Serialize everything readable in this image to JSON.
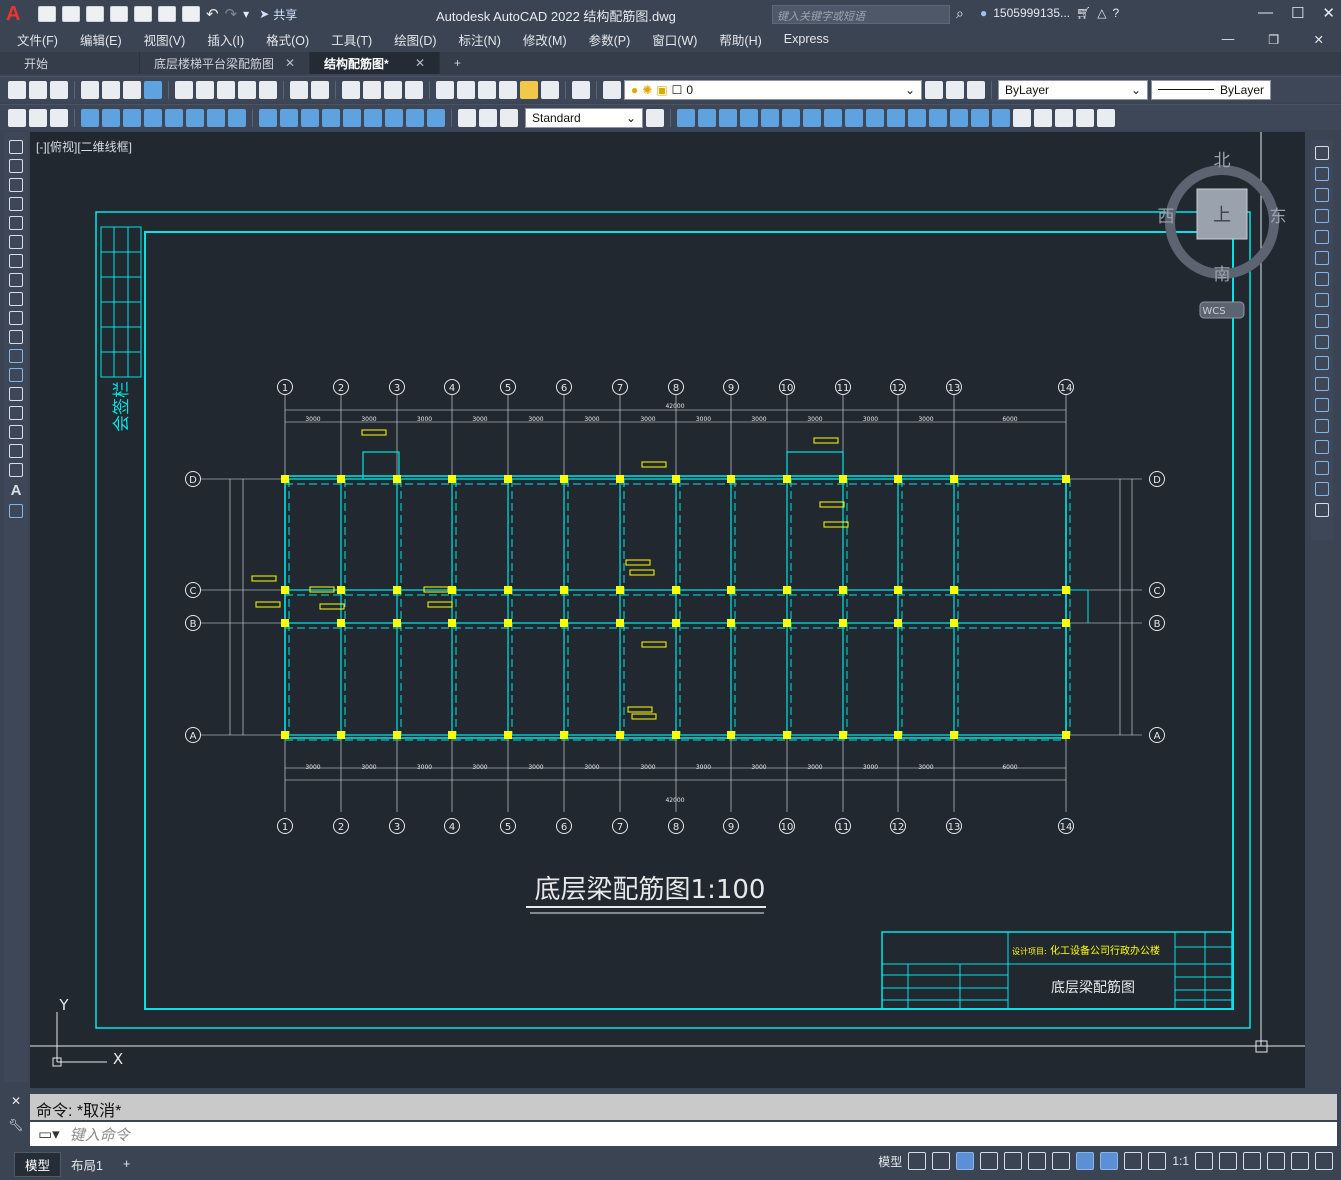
{
  "app": {
    "title": "Autodesk AutoCAD 2022    结构配筋图.dwg",
    "search_placeholder": "键入关键字或短语",
    "user": "1505999135...",
    "share": "共享"
  },
  "menu": [
    "文件(F)",
    "编辑(E)",
    "视图(V)",
    "插入(I)",
    "格式(O)",
    "工具(T)",
    "绘图(D)",
    "标注(N)",
    "修改(M)",
    "参数(P)",
    "窗口(W)",
    "帮助(H)",
    "Express"
  ],
  "tabs": [
    {
      "label": "开始"
    },
    {
      "label": "底层楼梯平台梁配筋图"
    },
    {
      "label": "结构配筋图*"
    }
  ],
  "toolbar": {
    "layer_value": "0",
    "color_value": "ByLayer",
    "linetype_value": "ByLayer",
    "text_style": "Standard"
  },
  "viewport": {
    "label": "[-][俯视][二维线框]",
    "compass": {
      "north": "北",
      "south": "南",
      "east": "东",
      "west": "西",
      "top": "上",
      "wcs": "WCS"
    },
    "ucs": {
      "x": "X",
      "y": "Y"
    }
  },
  "drawing": {
    "title": "底层梁配筋图1:100",
    "sign_column": "会签栏",
    "titleblock": {
      "project_label": "设计项目:",
      "project": "化工设备公司行政办公楼",
      "drawing_name": "底层梁配筋图"
    },
    "axes_top": [
      "1",
      "2",
      "3",
      "4",
      "5",
      "6",
      "7",
      "8",
      "9",
      "10",
      "11",
      "12",
      "13",
      "14"
    ],
    "axes_side": [
      "D",
      "C",
      "B",
      "A"
    ],
    "total_dim": "42000",
    "bay_dims": [
      "3000",
      "3000",
      "3000",
      "3000",
      "3000",
      "3000",
      "3000",
      "3000",
      "3000",
      "3000",
      "3000",
      "3000",
      "6000"
    ]
  },
  "command": {
    "history": "命令:  *取消*",
    "placeholder": "键入命令"
  },
  "status": {
    "layouts": [
      "模型",
      "布局1"
    ],
    "model_label": "模型",
    "scale": "1:1"
  },
  "colors": {
    "cyan": "#00e5e5",
    "yellow": "#ffff00",
    "white": "#e8e8e8",
    "bg": "#212830"
  }
}
